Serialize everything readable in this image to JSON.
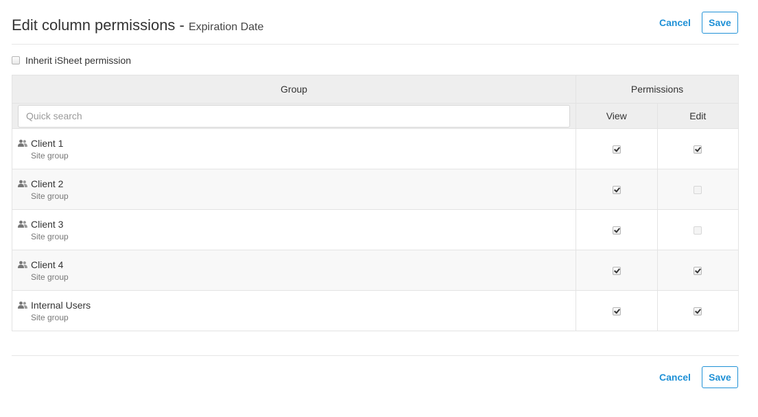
{
  "header": {
    "title": "Edit column permissions - ",
    "subtitle": "Expiration Date",
    "cancel_label": "Cancel",
    "save_label": "Save"
  },
  "inherit": {
    "label": "Inherit iSheet permission",
    "checked": false
  },
  "table": {
    "group_header": "Group",
    "permissions_header": "Permissions",
    "view_header": "View",
    "edit_header": "Edit",
    "search_placeholder": "Quick search",
    "rows": [
      {
        "name": "Client 1",
        "type": "Site group",
        "view": true,
        "edit": true
      },
      {
        "name": "Client 2",
        "type": "Site group",
        "view": true,
        "edit": false
      },
      {
        "name": "Client 3",
        "type": "Site group",
        "view": true,
        "edit": false
      },
      {
        "name": "Client 4",
        "type": "Site group",
        "view": true,
        "edit": true
      },
      {
        "name": "Internal Users",
        "type": "Site group",
        "view": true,
        "edit": true
      }
    ]
  },
  "footer": {
    "cancel_label": "Cancel",
    "save_label": "Save"
  },
  "icons": {
    "group": "users-icon"
  },
  "colors": {
    "accent": "#1e90d6"
  }
}
